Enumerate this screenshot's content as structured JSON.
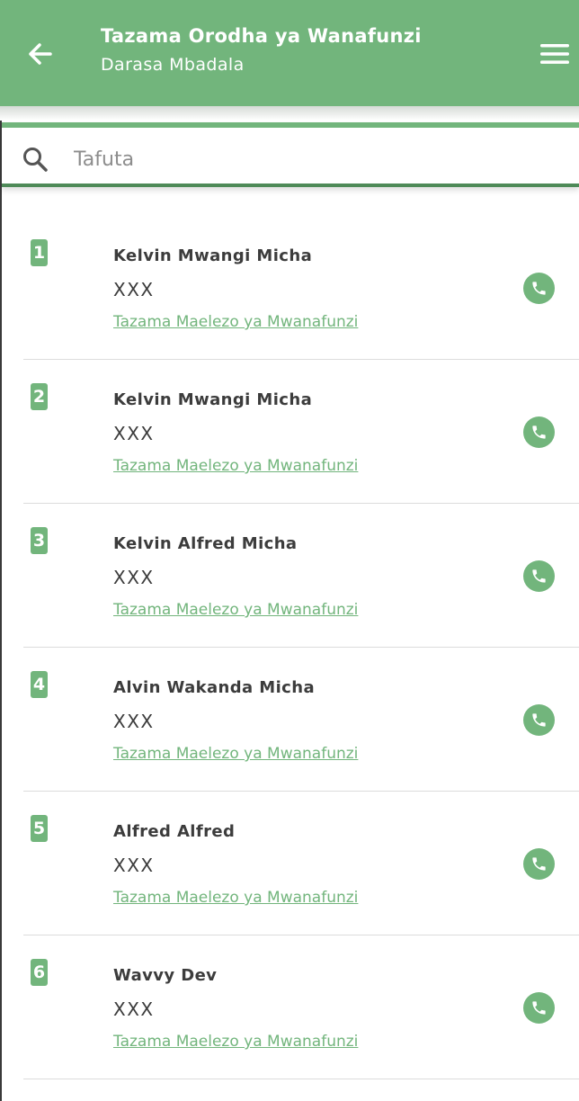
{
  "colors": {
    "accent": "#72b57c",
    "search_underline": "#4e8a58"
  },
  "header": {
    "title": "Tazama Orodha ya Wanafunzi",
    "subtitle": "Darasa Mbadala",
    "back_icon": "arrow-left-icon",
    "menu_icon": "hamburger-menu-icon"
  },
  "search": {
    "icon": "search-icon",
    "placeholder": "Tafuta",
    "value": ""
  },
  "students": [
    {
      "number": "1",
      "name": "Kelvin Mwangi Micha",
      "phone": "XXX",
      "details_link": "Tazama Maelezo ya Mwanafunzi",
      "call_icon": "phone-icon"
    },
    {
      "number": "2",
      "name": "Kelvin Mwangi Micha",
      "phone": "XXX",
      "details_link": "Tazama Maelezo ya Mwanafunzi",
      "call_icon": "phone-icon"
    },
    {
      "number": "3",
      "name": "Kelvin Alfred Micha",
      "phone": "XXX",
      "details_link": "Tazama Maelezo ya Mwanafunzi",
      "call_icon": "phone-icon"
    },
    {
      "number": "4",
      "name": "Alvin Wakanda Micha",
      "phone": "XXX",
      "details_link": "Tazama Maelezo ya Mwanafunzi",
      "call_icon": "phone-icon"
    },
    {
      "number": "5",
      "name": "Alfred Alfred",
      "phone": "XXX",
      "details_link": "Tazama Maelezo ya Mwanafunzi",
      "call_icon": "phone-icon"
    },
    {
      "number": "6",
      "name": "Wavvy Dev",
      "phone": "XXX",
      "details_link": "Tazama Maelezo ya Mwanafunzi",
      "call_icon": "phone-icon"
    }
  ]
}
